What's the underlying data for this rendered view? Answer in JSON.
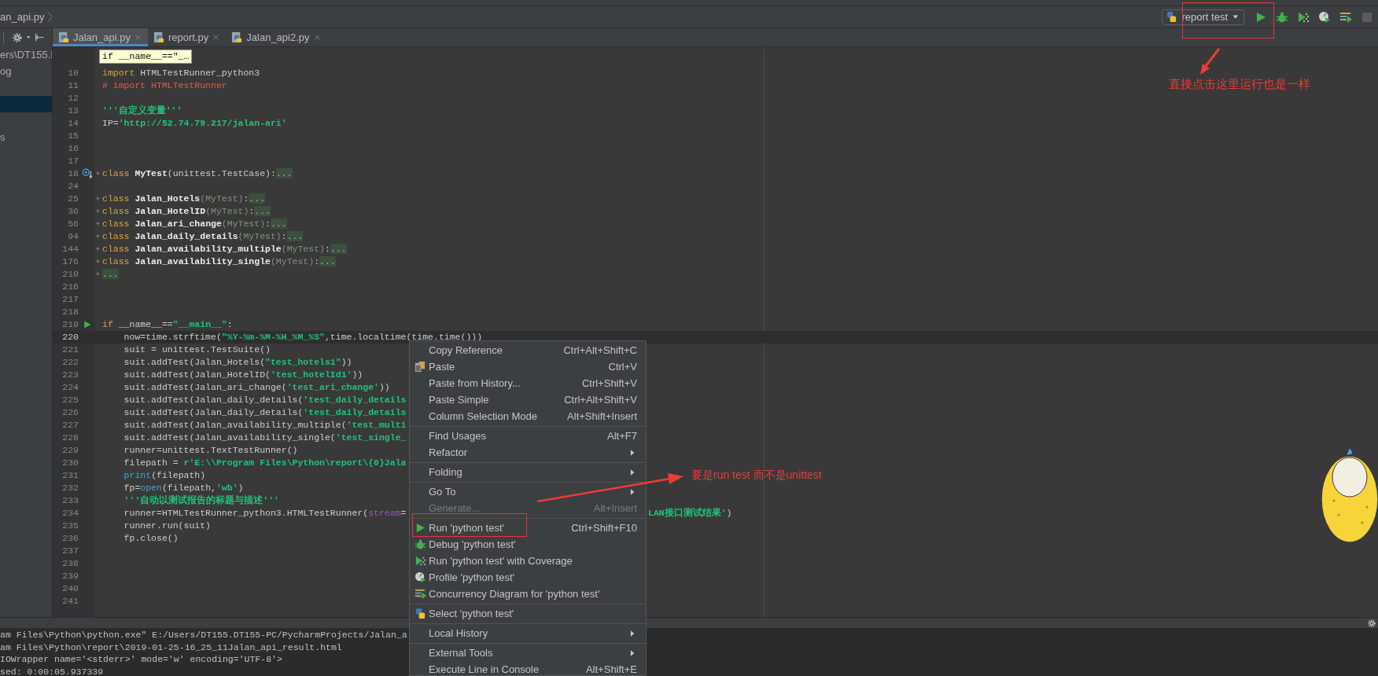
{
  "breadcrumb": {
    "label": "an_api.py"
  },
  "run_config": {
    "label": "report test"
  },
  "project_tree": {
    "items": [
      {
        "label": "ers\\DT155.I",
        "selected": false
      },
      {
        "label": "og",
        "selected": false
      },
      {
        "selected": true
      },
      {
        "label": "s",
        "selected": false
      }
    ]
  },
  "tabs": [
    {
      "label": "Jalan_api.py",
      "selected": true
    },
    {
      "label": "report.py",
      "selected": false
    },
    {
      "label": "Jalan_api2.py",
      "selected": false
    }
  ],
  "editor": {
    "tooltip": "if __name__==\"_…",
    "lines": [
      {
        "n": "10",
        "fold": false,
        "current": false,
        "segs": [
          {
            "kind": "kw",
            "text": "import"
          },
          {
            "kind": "plain",
            "text": " HTMLTestRunner_python3"
          }
        ]
      },
      {
        "n": "11",
        "fold": false,
        "current": false,
        "segs": [
          {
            "kind": "cmt",
            "text": "# import HTMLTestRunner"
          }
        ]
      },
      {
        "n": "12",
        "fold": false,
        "current": false
      },
      {
        "n": "13",
        "fold": false,
        "current": false,
        "segs": [
          {
            "kind": "doc",
            "text": "'''自定义变量'''"
          }
        ]
      },
      {
        "n": "14",
        "fold": false,
        "current": false,
        "segs": [
          {
            "kind": "plain",
            "text": "IP="
          },
          {
            "kind": "str",
            "text": "'http://52.74.79.217/jalan-ari'"
          }
        ]
      },
      {
        "n": "15",
        "fold": false,
        "current": false
      },
      {
        "n": "16",
        "fold": false,
        "current": false
      },
      {
        "n": "17",
        "fold": false,
        "current": false
      },
      {
        "n": "18",
        "fold": true,
        "current": false,
        "gutter": {
          "kind": "override"
        },
        "segs": [
          {
            "kind": "kw",
            "text": "class"
          },
          {
            "kind": "name",
            "text": " MyTest"
          },
          {
            "kind": "plain",
            "text": "(unittest.TestCase):"
          },
          {
            "kind": "fold",
            "text": "..."
          }
        ]
      },
      {
        "n": "24",
        "fold": false,
        "current": false
      },
      {
        "n": "25",
        "fold": true,
        "current": false,
        "segs": [
          {
            "kind": "kw",
            "text": "class"
          },
          {
            "kind": "name",
            "text": " Jalan_Hotels"
          },
          {
            "kind": "base",
            "text": "(MyTest)"
          },
          {
            "kind": "plain",
            "text": ":"
          },
          {
            "kind": "fold",
            "text": "..."
          }
        ]
      },
      {
        "n": "36",
        "fold": true,
        "current": false,
        "segs": [
          {
            "kind": "kw",
            "text": "class"
          },
          {
            "kind": "name",
            "text": " Jalan_HotelID"
          },
          {
            "kind": "base",
            "text": "(MyTest)"
          },
          {
            "kind": "plain",
            "text": ":"
          },
          {
            "kind": "fold",
            "text": "..."
          }
        ]
      },
      {
        "n": "56",
        "fold": true,
        "current": false,
        "segs": [
          {
            "kind": "kw",
            "text": "class"
          },
          {
            "kind": "name",
            "text": " Jalan_ari_change"
          },
          {
            "kind": "base",
            "text": "(MyTest)"
          },
          {
            "kind": "plain",
            "text": ":"
          },
          {
            "kind": "fold",
            "text": "..."
          }
        ]
      },
      {
        "n": "94",
        "fold": true,
        "current": false,
        "segs": [
          {
            "kind": "kw",
            "text": "class"
          },
          {
            "kind": "name",
            "text": " Jalan_daily_details"
          },
          {
            "kind": "base",
            "text": "(MyTest)"
          },
          {
            "kind": "plain",
            "text": ":"
          },
          {
            "kind": "fold",
            "text": "..."
          }
        ]
      },
      {
        "n": "144",
        "fold": true,
        "current": false,
        "segs": [
          {
            "kind": "kw",
            "text": "class"
          },
          {
            "kind": "name",
            "text": " Jalan_availability_multiple"
          },
          {
            "kind": "base",
            "text": "(MyTest)"
          },
          {
            "kind": "plain",
            "text": ":"
          },
          {
            "kind": "fold",
            "text": "..."
          }
        ]
      },
      {
        "n": "176",
        "fold": true,
        "current": false,
        "segs": [
          {
            "kind": "kw",
            "text": "class"
          },
          {
            "kind": "name",
            "text": " Jalan_availability_single"
          },
          {
            "kind": "base",
            "text": "(MyTest)"
          },
          {
            "kind": "plain",
            "text": ":"
          },
          {
            "kind": "fold",
            "text": "..."
          }
        ]
      },
      {
        "n": "210",
        "fold": true,
        "current": false,
        "segs": [
          {
            "kind": "fold",
            "text": "..."
          }
        ]
      },
      {
        "n": "216",
        "fold": false,
        "current": false
      },
      {
        "n": "217",
        "fold": false,
        "current": false
      },
      {
        "n": "218",
        "fold": false,
        "current": false
      },
      {
        "n": "219",
        "fold": false,
        "current": false,
        "gutter": {
          "kind": "run"
        },
        "segs": [
          {
            "kind": "kw",
            "text": "if"
          },
          {
            "kind": "plain",
            "text": " __name__=="
          },
          {
            "kind": "str",
            "text": "\"__main__\""
          },
          {
            "kind": "plain",
            "text": ":"
          }
        ]
      },
      {
        "n": "220",
        "fold": false,
        "current": true,
        "segs": [
          {
            "kind": "plain",
            "text": "    now=time.strftime("
          },
          {
            "kind": "str",
            "text": "\"%Y-%m-%M-%H_%M_%S\""
          },
          {
            "kind": "plain",
            "text": ",time.localtime(time.time()))"
          }
        ]
      },
      {
        "n": "221",
        "fold": false,
        "current": false,
        "segs": [
          {
            "kind": "plain",
            "text": "    suit = unittest.TestSuite()"
          }
        ]
      },
      {
        "n": "222",
        "fold": false,
        "current": false,
        "segs": [
          {
            "kind": "plain",
            "text": "    suit.addTest(Jalan_Hotels("
          },
          {
            "kind": "str",
            "text": "\"test_hotels1\""
          },
          {
            "kind": "plain",
            "text": "))"
          }
        ]
      },
      {
        "n": "223",
        "fold": false,
        "current": false,
        "segs": [
          {
            "kind": "plain",
            "text": "    suit.addTest(Jalan_HotelID("
          },
          {
            "kind": "str",
            "text": "'test_hotelId1'"
          },
          {
            "kind": "plain",
            "text": "))"
          }
        ]
      },
      {
        "n": "224",
        "fold": false,
        "current": false,
        "segs": [
          {
            "kind": "plain",
            "text": "    suit.addTest(Jalan_ari_change("
          },
          {
            "kind": "str",
            "text": "'test_ari_change'"
          },
          {
            "kind": "plain",
            "text": "))"
          }
        ]
      },
      {
        "n": "225",
        "fold": false,
        "current": false,
        "segs": [
          {
            "kind": "plain",
            "text": "    suit.addTest(Jalan_daily_details("
          },
          {
            "kind": "str",
            "text": "'test_daily_details"
          }
        ]
      },
      {
        "n": "226",
        "fold": false,
        "current": false,
        "segs": [
          {
            "kind": "plain",
            "text": "    suit.addTest(Jalan_daily_details("
          },
          {
            "kind": "str",
            "text": "'test_daily_details"
          }
        ]
      },
      {
        "n": "227",
        "fold": false,
        "current": false,
        "segs": [
          {
            "kind": "plain",
            "text": "    suit.addTest(Jalan_availability_multiple("
          },
          {
            "kind": "str",
            "text": "'test_multi"
          }
        ]
      },
      {
        "n": "228",
        "fold": false,
        "current": false,
        "segs": [
          {
            "kind": "plain",
            "text": "    suit.addTest(Jalan_availability_single("
          },
          {
            "kind": "str",
            "text": "'test_single_"
          }
        ]
      },
      {
        "n": "229",
        "fold": false,
        "current": false,
        "segs": [
          {
            "kind": "plain",
            "text": "    runner=unittest.TextTestRunner()"
          }
        ]
      },
      {
        "n": "230",
        "fold": false,
        "current": false,
        "segs": [
          {
            "kind": "plain",
            "text": "    filepath = "
          },
          {
            "kind": "str",
            "text": "r'E:\\\\Program Files\\Python\\report\\{0}Jala"
          }
        ]
      },
      {
        "n": "231",
        "fold": false,
        "current": false,
        "segs": [
          {
            "kind": "builtin",
            "text": "    print"
          },
          {
            "kind": "plain",
            "text": "(filepath)"
          }
        ]
      },
      {
        "n": "232",
        "fold": false,
        "current": false,
        "segs": [
          {
            "kind": "plain",
            "text": "    fp="
          },
          {
            "kind": "builtin",
            "text": "open"
          },
          {
            "kind": "plain",
            "text": "(filepath,"
          },
          {
            "kind": "str",
            "text": "'wb'"
          },
          {
            "kind": "plain",
            "text": ")"
          }
        ]
      },
      {
        "n": "233",
        "fold": false,
        "current": false,
        "segs": [
          {
            "kind": "doc",
            "text": "    '''自动以测试报告的标题与描述'''"
          }
        ]
      },
      {
        "n": "234",
        "fold": false,
        "current": false,
        "segs": [
          {
            "kind": "plain",
            "text": "    runner=HTMLTestRunner_python3.HTMLTestRunner("
          },
          {
            "kind": "param",
            "text": "stream"
          },
          {
            "kind": "plain",
            "text": "="
          }
        ],
        "tail": [
          {
            "kind": "str",
            "text": "LAN接口测试结果'"
          },
          {
            "kind": "plain",
            "text": ")"
          }
        ]
      },
      {
        "n": "235",
        "fold": false,
        "current": false,
        "segs": [
          {
            "kind": "plain",
            "text": "    runner.run(suit)"
          }
        ]
      },
      {
        "n": "236",
        "fold": false,
        "current": false,
        "segs": [
          {
            "kind": "plain",
            "text": "    fp.close()"
          }
        ]
      },
      {
        "n": "237",
        "fold": false,
        "current": false
      },
      {
        "n": "238",
        "fold": false,
        "current": false
      },
      {
        "n": "239",
        "fold": false,
        "current": false
      },
      {
        "n": "240",
        "fold": false,
        "current": false
      },
      {
        "n": "241",
        "fold": false,
        "current": false
      }
    ]
  },
  "console": {
    "lines": [
      "am Files\\Python\\python.exe\" E:/Users/DT155.DT155-PC/PycharmProjects/Jalan_a",
      "am Files\\Python\\report\\2019-01-25-16_25_11Jalan_api_result.html",
      "IOWrapper name='<stderr>' mode='w' encoding='UTF-8'>",
      "sed: 0:00:05.937339"
    ]
  },
  "context_menu": {
    "groups": [
      [
        {
          "label": "Copy Reference",
          "shortcut": "Ctrl+Alt+Shift+C",
          "kind": "plain",
          "submenu": false,
          "disabled": false
        },
        {
          "label": "Paste",
          "shortcut": "Ctrl+V",
          "kind": "paste",
          "submenu": false,
          "disabled": false
        },
        {
          "label": "Paste from History...",
          "shortcut": "Ctrl+Shift+V",
          "kind": "plain",
          "submenu": false,
          "disabled": false
        },
        {
          "label": "Paste Simple",
          "shortcut": "Ctrl+Alt+Shift+V",
          "kind": "plain",
          "submenu": false,
          "disabled": false
        },
        {
          "label": "Column Selection Mode",
          "shortcut": "Alt+Shift+Insert",
          "kind": "plain",
          "submenu": false,
          "disabled": false
        }
      ],
      [
        {
          "label": "Find Usages",
          "shortcut": "Alt+F7",
          "kind": "plain",
          "submenu": false,
          "disabled": false
        },
        {
          "label": "Refactor",
          "kind": "plain",
          "submenu": true,
          "disabled": false
        }
      ],
      [
        {
          "label": "Folding",
          "kind": "plain",
          "submenu": true,
          "disabled": false
        }
      ],
      [
        {
          "label": "Go To",
          "kind": "plain",
          "submenu": true,
          "disabled": false
        },
        {
          "label": "Generate...",
          "shortcut": "Alt+Insert",
          "kind": "plain",
          "submenu": false,
          "disabled": true
        }
      ],
      [
        {
          "label": "Run 'python test'",
          "shortcut": "Ctrl+Shift+F10",
          "kind": "run",
          "submenu": false,
          "disabled": false
        },
        {
          "label": "Debug 'python test'",
          "kind": "debug",
          "submenu": false,
          "disabled": false
        },
        {
          "label": "Run 'python test' with Coverage",
          "kind": "coverage",
          "submenu": false,
          "disabled": false
        },
        {
          "label": "Profile 'python test'",
          "kind": "profile",
          "submenu": false,
          "disabled": false
        },
        {
          "label": "Concurrency Diagram for  'python test'",
          "kind": "concurrency",
          "submenu": false,
          "disabled": false
        }
      ],
      [
        {
          "label": "Select 'python test'",
          "kind": "python",
          "submenu": false,
          "disabled": false
        }
      ],
      [
        {
          "label": "Local History",
          "kind": "plain",
          "submenu": true,
          "disabled": false
        }
      ],
      [
        {
          "label": "External Tools",
          "kind": "plain",
          "submenu": true,
          "disabled": false
        },
        {
          "label": "Execute Line in Console",
          "shortcut": "Alt+Shift+E",
          "kind": "plain",
          "submenu": false,
          "disabled": false
        }
      ]
    ]
  },
  "annotations": [
    {
      "kind": "toolbar",
      "text": "直接点击这里运行也是一样"
    },
    {
      "kind": "menu",
      "text": "要是run test 而不是unittest"
    }
  ]
}
